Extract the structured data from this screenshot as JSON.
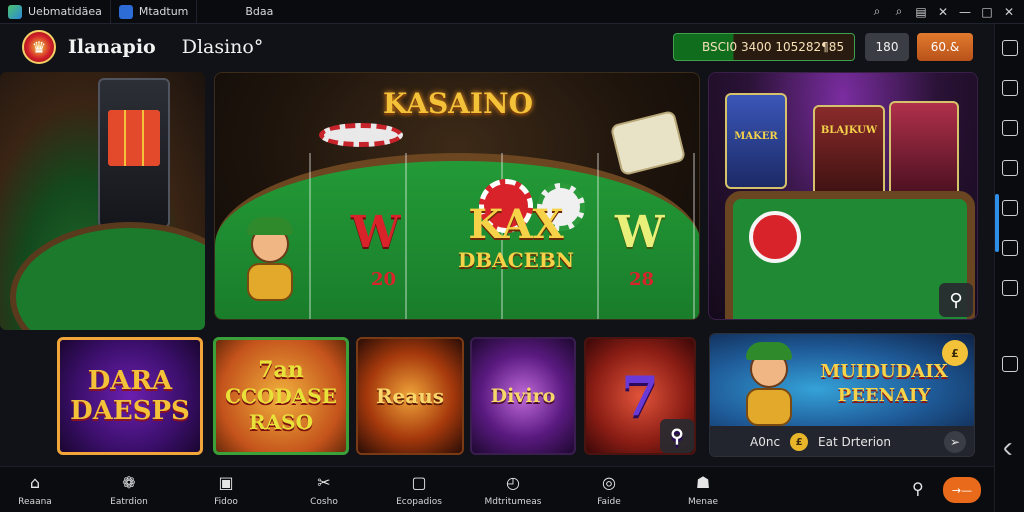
{
  "titlebar": {
    "tab1": "Uebmatidäea",
    "tab2": "Mtadtum",
    "tab3": "Bdaa",
    "actions": [
      "⌕",
      "⌕",
      "▤",
      "✕",
      "—",
      "□",
      "✕"
    ]
  },
  "header": {
    "logo_glyph": "♛",
    "brand": "Ilanapio",
    "brand2": "Dlasino°",
    "balance": "BSCI0 3400 105282¶85",
    "gray_button": "180",
    "orange_button": "60.&"
  },
  "hero": {
    "title": "KASAINO",
    "left_w": "W",
    "left_num": "20",
    "right_w": "W",
    "right_num": "28",
    "center_big": "KAX",
    "center_small": "DBACEBN"
  },
  "side_banner": {
    "cab_a_label": "MAKER",
    "cab_b_label": "BLAJKUW"
  },
  "tiles": [
    {
      "line1": "DARA",
      "line2": "DAESPS"
    },
    {
      "line1": "7an",
      "line2": "CCODASE",
      "line3": "RASO"
    },
    {
      "line1": "Reaus"
    },
    {
      "line1": "Diviro"
    },
    {
      "line1": "7"
    }
  ],
  "promo": {
    "title": "MUIDUDAIX PEENAIY",
    "coin": "£",
    "footer_a": "A0nc",
    "footer_dot": "£",
    "footer_b": "Eat Drterion"
  },
  "bottom_nav": [
    {
      "icon": "⌂",
      "label": "Reaana"
    },
    {
      "icon": "❁",
      "label": "Eatrdion"
    },
    {
      "icon": "▣",
      "label": "Fidoo"
    },
    {
      "icon": "✂",
      "label": "Cosho"
    },
    {
      "icon": "▢",
      "label": "Ecopadios"
    },
    {
      "icon": "◴",
      "label": "Mdtritumeas"
    },
    {
      "icon": "◎",
      "label": "Faide"
    },
    {
      "icon": "☗",
      "label": "Menae"
    }
  ],
  "bottom_cta": "→—"
}
